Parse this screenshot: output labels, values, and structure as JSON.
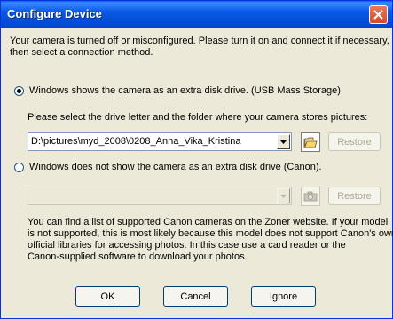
{
  "window": {
    "title": "Configure Device"
  },
  "intro": [
    "Your camera is turned off or misconfigured. Please turn it on and connect it if necessary,",
    "then select a connection method."
  ],
  "option_usb": {
    "label": "Windows shows the camera as an extra disk drive. (USB Mass Storage)",
    "selected": true,
    "prompt": "Please select the drive letter and the folder where your camera stores pictures:",
    "path_value": "D:\\pictures\\myd_2008\\0208_Anna_Vika_Kristina",
    "restore_label": "Restore",
    "browse_icon": "folder-open-icon"
  },
  "option_canon": {
    "label": "Windows does not show the camera as an extra disk drive (Canon).",
    "selected": false,
    "device_value": "",
    "restore_label": "Restore",
    "camera_icon": "camera-icon"
  },
  "info": [
    "You can find a list of supported Canon cameras on the Zoner website. If your model",
    "is not supported, this is most likely because this model does not support Canon's own",
    "official libraries for accessing photos. In this case use a card reader or the",
    "Canon-supplied software to download your photos."
  ],
  "buttons": {
    "ok": "OK",
    "cancel": "Cancel",
    "ignore": "Ignore"
  },
  "colors": {
    "titlebar": "#0a58e8",
    "window_bg": "#ece9d8",
    "disabled_text": "#aca899"
  }
}
